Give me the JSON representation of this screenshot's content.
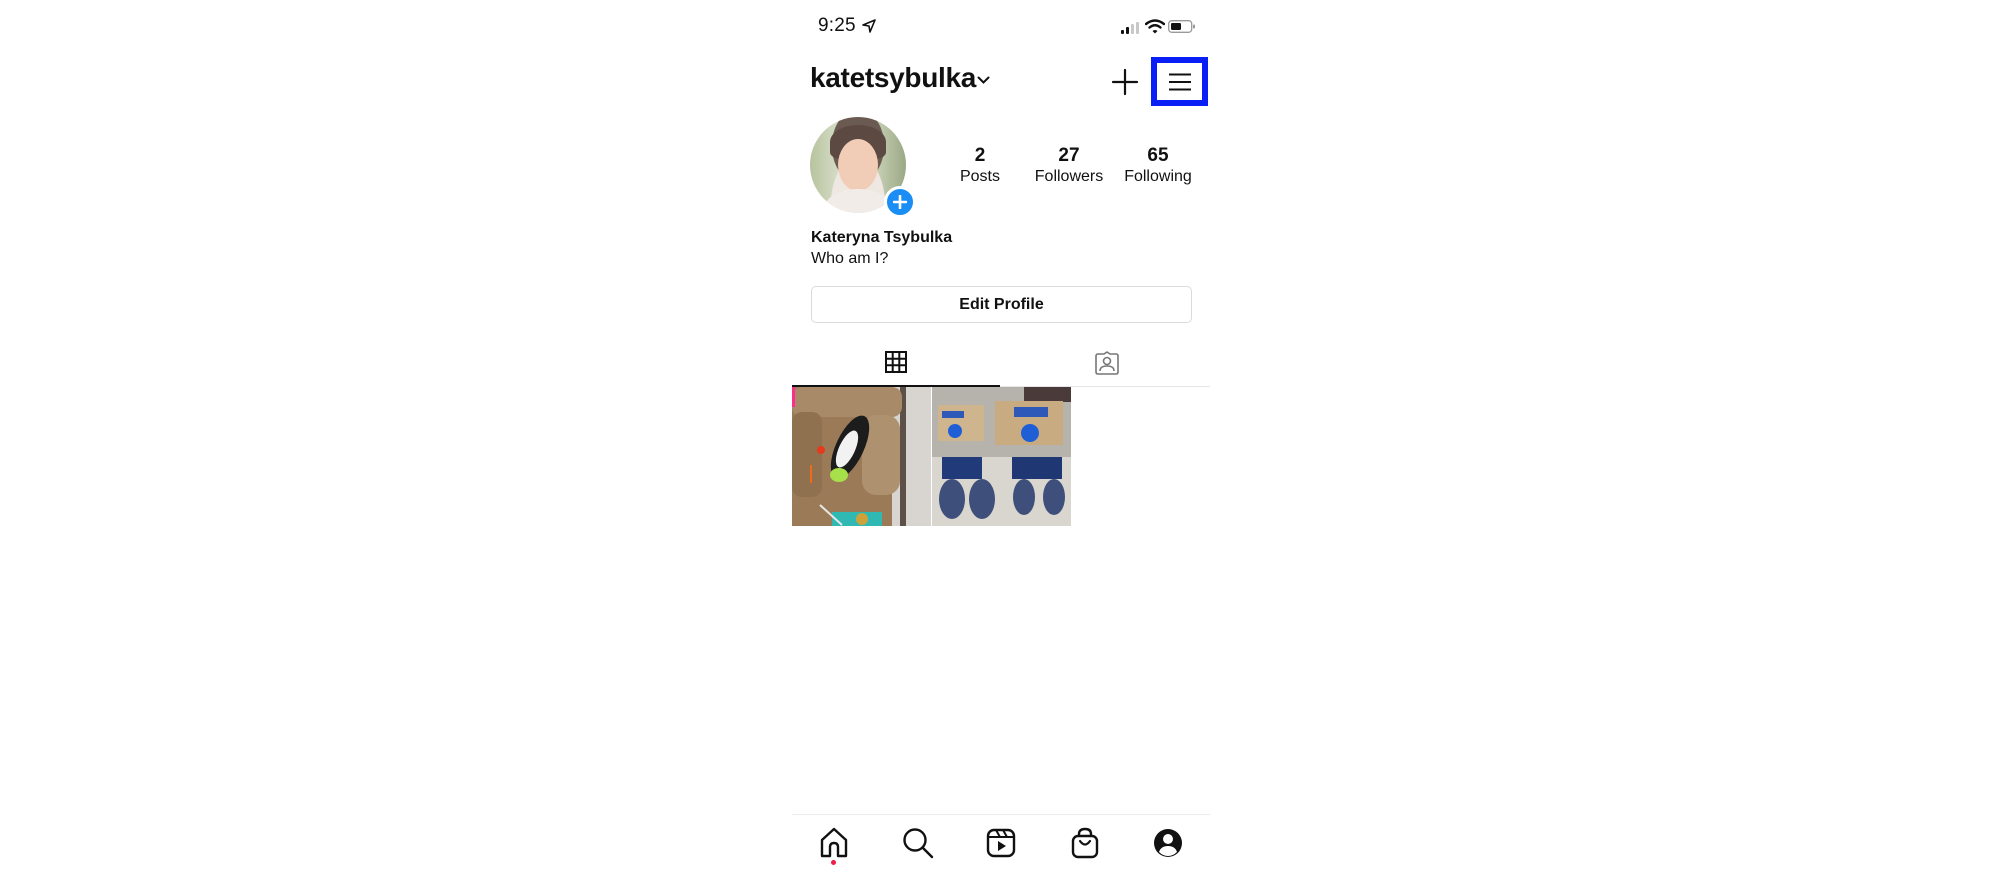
{
  "status_bar": {
    "time": "9:25",
    "icons": [
      "location-arrow-icon",
      "cellular-signal-icon",
      "wifi-icon",
      "battery-icon"
    ]
  },
  "header": {
    "username": "katetsybulka",
    "icons": [
      "chevron-down-icon",
      "plus-icon",
      "hamburger-menu-icon"
    ]
  },
  "profile": {
    "avatar_alt": "Profile photo",
    "stats": [
      {
        "value": "2",
        "label": "Posts"
      },
      {
        "value": "27",
        "label": "Followers"
      },
      {
        "value": "65",
        "label": "Following"
      }
    ],
    "full_name": "Kateryna Tsybulka",
    "bio": "Who am I?",
    "edit_button": "Edit Profile"
  },
  "tabs": [
    {
      "name": "posts-grid",
      "icon": "grid-icon",
      "active": true
    },
    {
      "name": "tagged",
      "icon": "tagged-person-icon",
      "active": false
    }
  ],
  "posts": [
    {
      "description": "Black and white cat lying on a tan armchair"
    },
    {
      "description": "Two Keds shoe boxes above a photo of blue sneakers"
    }
  ],
  "bottom_nav": [
    {
      "name": "home",
      "icon": "home-icon",
      "has_notification_dot": true
    },
    {
      "name": "search",
      "icon": "search-icon"
    },
    {
      "name": "reels",
      "icon": "reels-icon"
    },
    {
      "name": "shop",
      "icon": "shopping-bag-icon"
    },
    {
      "name": "profile",
      "icon": "profile-icon"
    }
  ],
  "colors": {
    "highlight_box": "#0a1ff5",
    "add_story_badge": "#1a8ef5",
    "notification_dot": "#ed1f45"
  }
}
